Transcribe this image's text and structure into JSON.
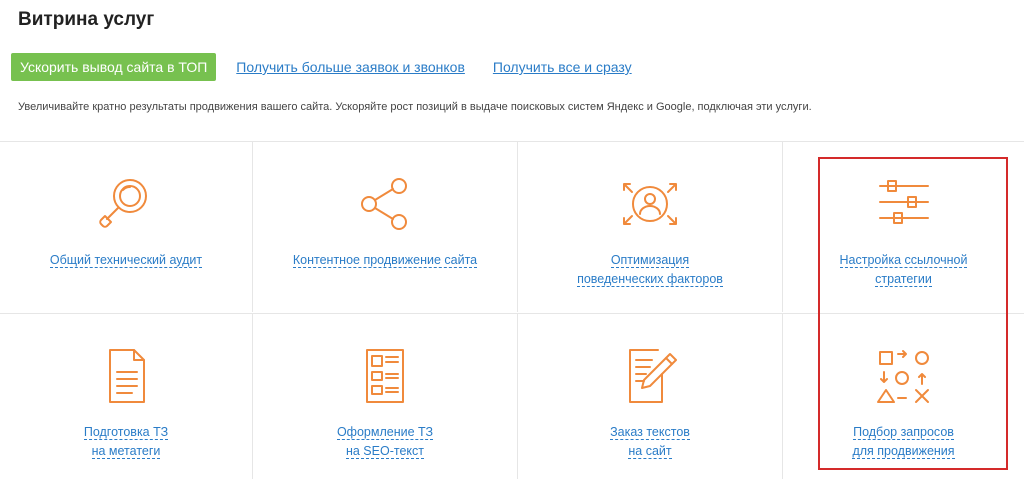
{
  "page": {
    "title": "Витрина услуг",
    "description": "Увеличивайте кратно результаты продвижения вашего сайта. Ускоряйте рост позиций в выдаче поисковых систем Яндекс и Google, подключая эти услуги."
  },
  "tabs": [
    {
      "label": "Ускорить вывод сайта в ТОП",
      "active": true
    },
    {
      "label": "Получить больше заявок и звонков",
      "active": false
    },
    {
      "label": "Получить все и сразу",
      "active": false
    }
  ],
  "services": [
    {
      "line1": "Общий технический аудит",
      "line2": "",
      "icon": "magnifier-icon"
    },
    {
      "line1": "Контентное продвижение сайта",
      "line2": "",
      "icon": "share-icon"
    },
    {
      "line1": "Оптимизация",
      "line2": "поведенческих факторов",
      "icon": "user-target-icon"
    },
    {
      "line1": "Настройка ссылочной",
      "line2": "стратегии",
      "icon": "sliders-icon"
    },
    {
      "line1": "Подготовка ТЗ",
      "line2": "на метатеги",
      "icon": "document-icon"
    },
    {
      "line1": "Оформление ТЗ",
      "line2": "на SEO-текст",
      "icon": "text-layout-icon"
    },
    {
      "line1": "Заказ текстов",
      "line2": "на сайт",
      "icon": "edit-document-icon"
    },
    {
      "line1": "Подбор запросов",
      "line2": "для продвижения",
      "icon": "strategy-icon"
    }
  ],
  "colors": {
    "accent": "#77c14f",
    "link": "#2a7cc7",
    "icon": "#f08a3c",
    "highlight": "#d42a2a"
  }
}
